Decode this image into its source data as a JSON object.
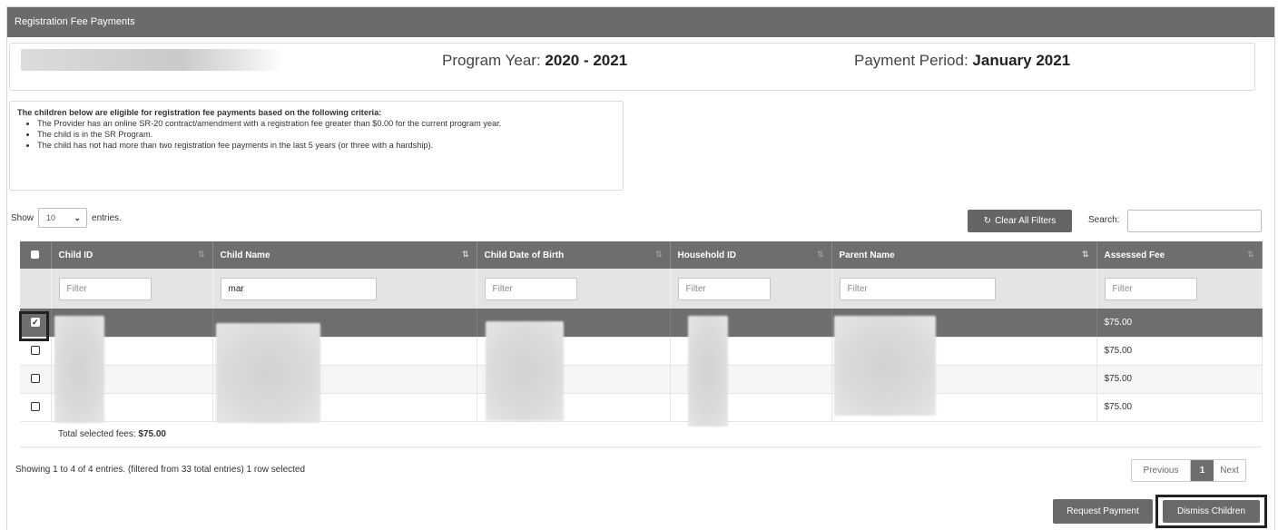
{
  "panel": {
    "title": "Registration Fee Payments"
  },
  "info": {
    "program_year_label": "Program Year:",
    "program_year_value": "2020 - 2021",
    "payment_period_label": "Payment Period:",
    "payment_period_value": "January 2021"
  },
  "criteria": {
    "lead": "The children below are eligible for registration fee payments based on the following criteria:",
    "items": [
      "The Provider has an online SR-20 contract/amendment with a registration fee greater than $0.00 for the current program year.",
      "The child is in the SR Program.",
      "The child has not had more than two registration fee payments in the last 5 years (or three with a hardship)."
    ]
  },
  "length": {
    "show_label": "Show",
    "selected": "10",
    "entries_label": "entries."
  },
  "toolbar": {
    "clear_filters_label": "Clear All Filters",
    "search_label": "Search:",
    "search_value": ""
  },
  "table": {
    "columns": [
      "Child ID",
      "Child Name",
      "Child Date of Birth",
      "Household ID",
      "Parent Name",
      "Assessed Fee"
    ],
    "filters": [
      "Filter",
      "mar",
      "Filter",
      "Filter",
      "Filter",
      "Filter"
    ],
    "rows": [
      {
        "fee": "$75.00",
        "selected": true
      },
      {
        "fee": "$75.00",
        "selected": false
      },
      {
        "fee": "$75.00",
        "selected": false
      },
      {
        "fee": "$75.00",
        "selected": false
      }
    ],
    "total_label": "Total selected fees:",
    "total_value": "$75.00"
  },
  "footer": {
    "showing": "Showing 1 to 4 of 4 entries. (filtered from 33 total entries)   1 row selected",
    "prev_label": "Previous",
    "current_page": "1",
    "next_label": "Next"
  },
  "actions": {
    "request_payment": "Request Payment",
    "dismiss_children": "Dismiss Children"
  },
  "colors": {
    "header_bg": "#6b6b6b",
    "selected_row_bg": "#6e6e6e",
    "filter_row_bg": "#e4e4e4"
  },
  "icons": {
    "refresh": "refresh-icon",
    "sort": "sort-icon",
    "dropdown": "chevron-down-icon"
  }
}
